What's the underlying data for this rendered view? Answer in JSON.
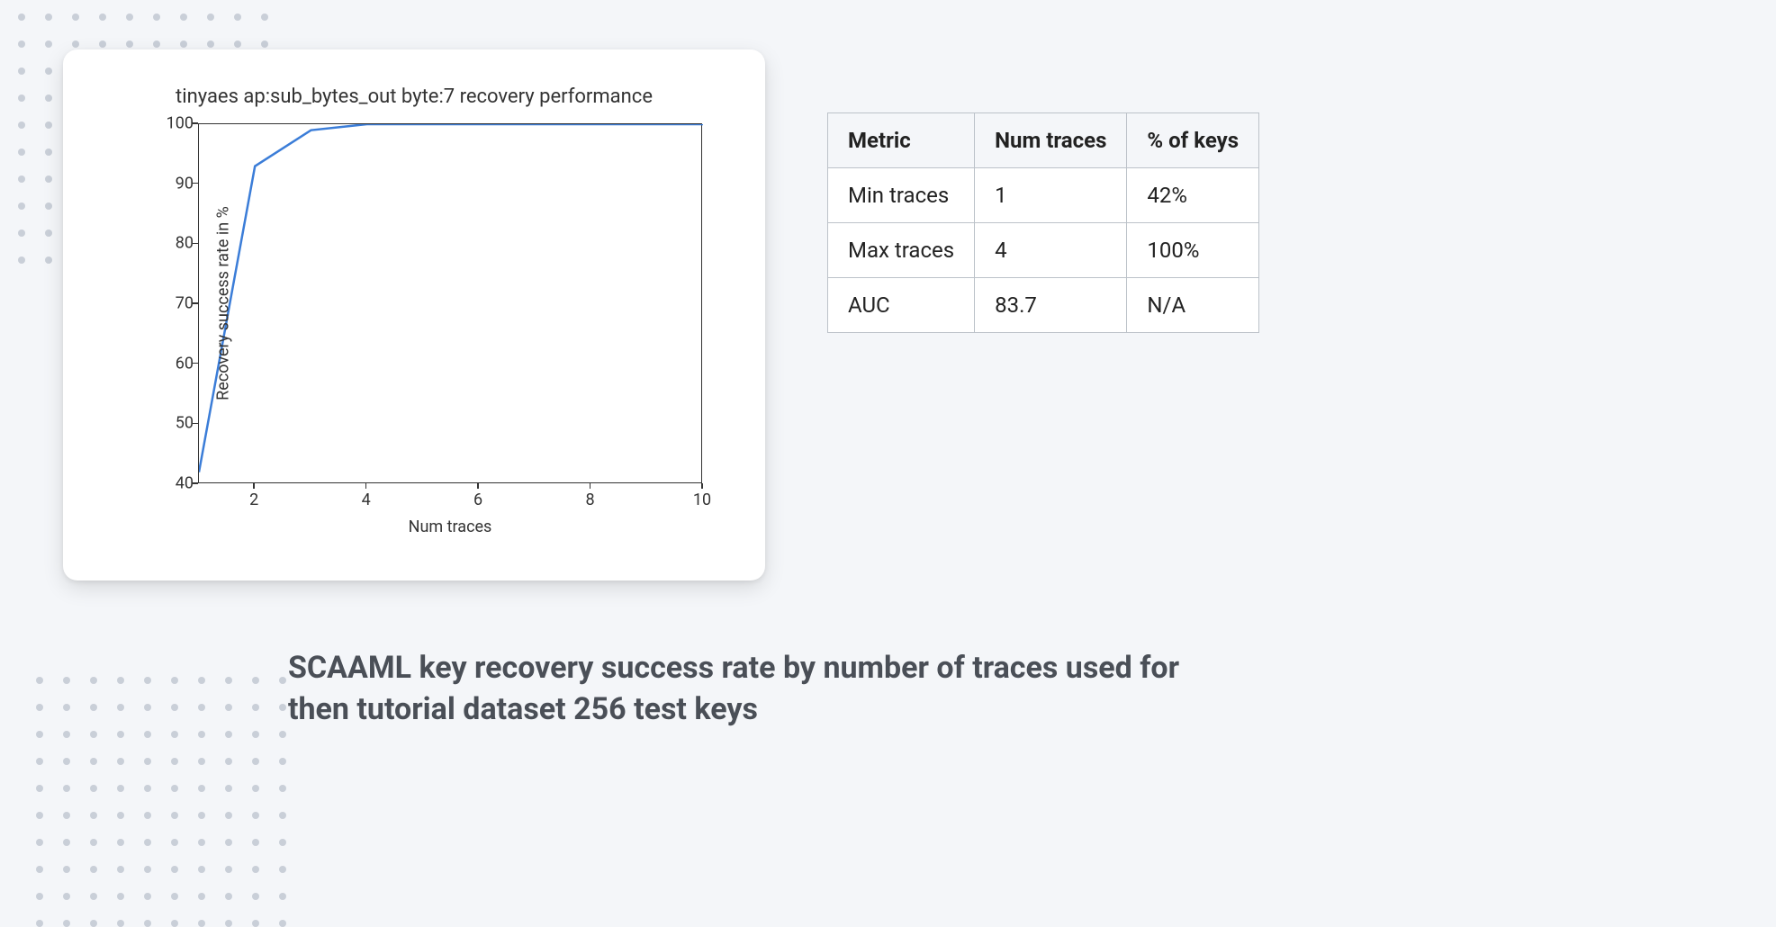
{
  "chart_data": {
    "type": "line",
    "title": "tinyaes ap:sub_bytes_out byte:7 recovery performance",
    "xlabel": "Num traces",
    "ylabel": "Recovery success rate in %",
    "x": [
      1,
      2,
      3,
      4,
      5,
      6,
      7,
      8,
      9,
      10
    ],
    "y": [
      42,
      93,
      99,
      100,
      100,
      100,
      100,
      100,
      100,
      100
    ],
    "xticks": [
      2,
      4,
      6,
      8,
      10
    ],
    "yticks": [
      40,
      50,
      60,
      70,
      80,
      90,
      100
    ],
    "xlim": [
      1,
      10
    ],
    "ylim": [
      40,
      100
    ]
  },
  "table": {
    "headers": [
      "Metric",
      "Num traces",
      "% of keys"
    ],
    "rows": [
      {
        "metric": "Min traces",
        "num_traces": "1",
        "pct": "42%"
      },
      {
        "metric": "Max traces",
        "num_traces": "4",
        "pct": "100%"
      },
      {
        "metric": "AUC",
        "num_traces": "83.7",
        "pct": "N/A"
      }
    ]
  },
  "caption": "SCAAML key recovery success rate by number of traces used for then tutorial dataset 256 test keys"
}
